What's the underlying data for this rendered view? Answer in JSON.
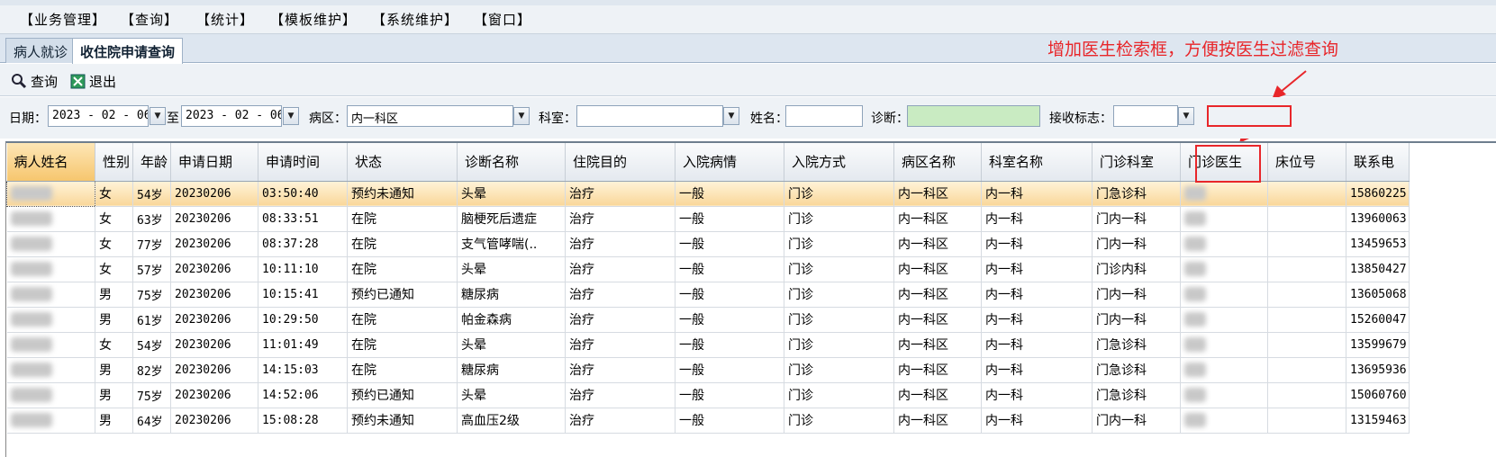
{
  "menu": [
    "【业务管理】",
    "【查询】",
    "【统计】",
    "【模板维护】",
    "【系统维护】",
    "【窗口】"
  ],
  "tabs": [
    "病人就诊",
    "收住院申请查询"
  ],
  "toolbar": {
    "query_label": "查询",
    "exit_label": "退出"
  },
  "annotation": "增加医生检索框，方便按医生过滤查询",
  "filters": {
    "date_label": "日期：",
    "date_from": "2023 - 02 - 06",
    "to_label": "至",
    "date_to": "2023 - 02 - 06",
    "ward_label": "病区：",
    "ward_value": "内一科区",
    "dept_label": "科室：",
    "dept_value": "",
    "name_label": "姓名：",
    "name_value": "",
    "diag_label": "诊断：",
    "diag_value": "",
    "recv_label": "接收标志：",
    "recv_value": "",
    "doctor_value": ""
  },
  "colors": {
    "annotation": "#e8262a",
    "selected_row": "#f9d79a",
    "diag_field": "#c9ebc2"
  },
  "table": {
    "columns": [
      "病人姓名",
      "性别",
      "年龄",
      "申请日期",
      "申请时间",
      "状态",
      "诊断名称",
      "住院目的",
      "入院病情",
      "入院方式",
      "病区名称",
      "科室名称",
      "门诊科室",
      "门诊医生",
      "床位号",
      "联系电"
    ],
    "rows": [
      {
        "sex": "女",
        "age": "54岁",
        "date": "20230206",
        "time": "03:50:40",
        "status": "预约未通知",
        "diag": "头晕",
        "purpose": "治疗",
        "cond": "一般",
        "mode": "门诊",
        "ward": "内一科区",
        "dept": "内一科",
        "opdept": "门急诊科",
        "phone": "15860225"
      },
      {
        "sex": "女",
        "age": "63岁",
        "date": "20230206",
        "time": "08:33:51",
        "status": "在院",
        "diag": "脑梗死后遗症",
        "purpose": "治疗",
        "cond": "一般",
        "mode": "门诊",
        "ward": "内一科区",
        "dept": "内一科",
        "opdept": "门内一科",
        "phone": "13960063"
      },
      {
        "sex": "女",
        "age": "77岁",
        "date": "20230206",
        "time": "08:37:28",
        "status": "在院",
        "diag": "支气管哮喘(..",
        "purpose": "治疗",
        "cond": "一般",
        "mode": "门诊",
        "ward": "内一科区",
        "dept": "内一科",
        "opdept": "门内一科",
        "phone": "13459653"
      },
      {
        "sex": "女",
        "age": "57岁",
        "date": "20230206",
        "time": "10:11:10",
        "status": "在院",
        "diag": "头晕",
        "purpose": "治疗",
        "cond": "一般",
        "mode": "门诊",
        "ward": "内一科区",
        "dept": "内一科",
        "opdept": "门诊内科",
        "phone": "13850427"
      },
      {
        "sex": "男",
        "age": "75岁",
        "date": "20230206",
        "time": "10:15:41",
        "status": "预约已通知",
        "diag": "糖尿病",
        "purpose": "治疗",
        "cond": "一般",
        "mode": "门诊",
        "ward": "内一科区",
        "dept": "内一科",
        "opdept": "门内一科",
        "phone": "13605068"
      },
      {
        "sex": "男",
        "age": "61岁",
        "date": "20230206",
        "time": "10:29:50",
        "status": "在院",
        "diag": "帕金森病",
        "purpose": "治疗",
        "cond": "一般",
        "mode": "门诊",
        "ward": "内一科区",
        "dept": "内一科",
        "opdept": "门内一科",
        "phone": "15260047"
      },
      {
        "sex": "女",
        "age": "54岁",
        "date": "20230206",
        "time": "11:01:49",
        "status": "在院",
        "diag": "头晕",
        "purpose": "治疗",
        "cond": "一般",
        "mode": "门诊",
        "ward": "内一科区",
        "dept": "内一科",
        "opdept": "门急诊科",
        "phone": "13599679"
      },
      {
        "sex": "男",
        "age": "82岁",
        "date": "20230206",
        "time": "14:15:03",
        "status": "在院",
        "diag": "糖尿病",
        "purpose": "治疗",
        "cond": "一般",
        "mode": "门诊",
        "ward": "内一科区",
        "dept": "内一科",
        "opdept": "门急诊科",
        "phone": "13695936"
      },
      {
        "sex": "男",
        "age": "75岁",
        "date": "20230206",
        "time": "14:52:06",
        "status": "预约已通知",
        "diag": "头晕",
        "purpose": "治疗",
        "cond": "一般",
        "mode": "门诊",
        "ward": "内一科区",
        "dept": "内一科",
        "opdept": "门急诊科",
        "phone": "15060760"
      },
      {
        "sex": "男",
        "age": "64岁",
        "date": "20230206",
        "time": "15:08:28",
        "status": "预约未通知",
        "diag": "高血压2级",
        "purpose": "治疗",
        "cond": "一般",
        "mode": "门诊",
        "ward": "内一科区",
        "dept": "内一科",
        "opdept": "门内一科",
        "phone": "13159463"
      }
    ]
  }
}
